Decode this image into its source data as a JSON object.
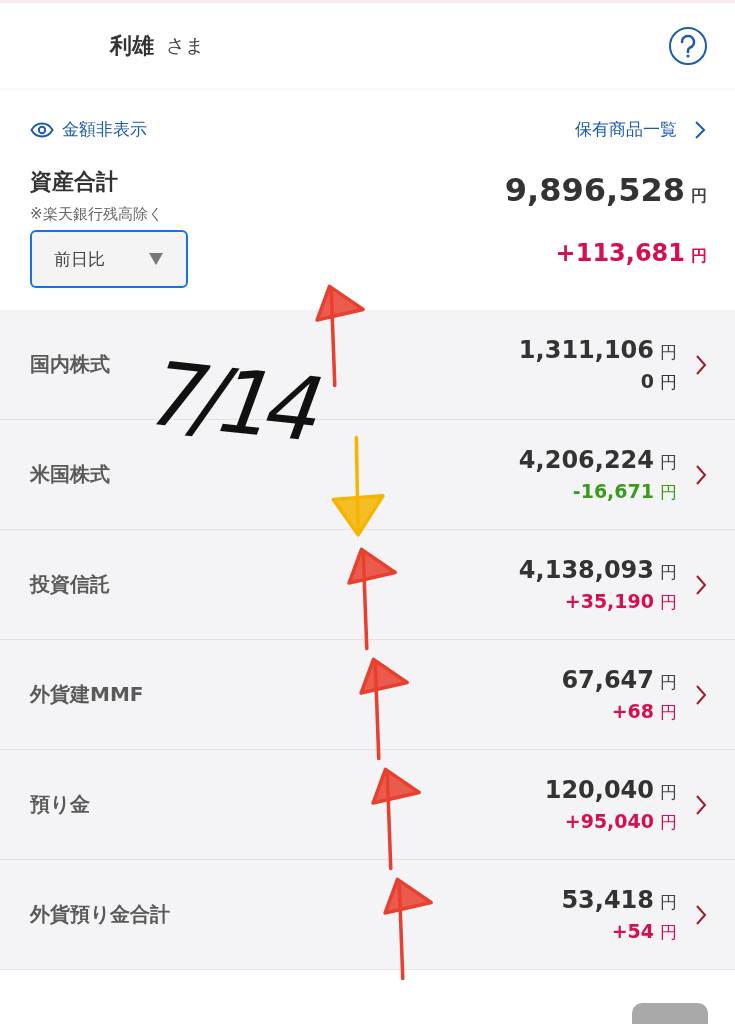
{
  "header": {
    "name": "利雄",
    "honorific": "さま"
  },
  "summary": {
    "hide_link": "金額非表示",
    "holdings_link": "保有商品一覧",
    "title": "資産合計",
    "note": "※楽天銀行残高除く",
    "period_select": "前日比",
    "total": "9,896,528",
    "total_unit": "円",
    "change": "+113,681",
    "change_unit": "円",
    "arrow": {
      "kind": "up",
      "color": "#e8402f"
    }
  },
  "handwritten_note": "7/14",
  "assets": [
    {
      "name": "国内株式",
      "amount": "1,311,106",
      "amount_unit": "円",
      "change": "0",
      "change_unit": "円",
      "color": "#333333"
    },
    {
      "name": "米国株式",
      "amount": "4,206,224",
      "amount_unit": "円",
      "change": "-16,671",
      "change_unit": "円",
      "color": "#3a9a1a",
      "arrow": {
        "kind": "down",
        "color": "#f5b400"
      }
    },
    {
      "name": "投資信託",
      "amount": "4,138,093",
      "amount_unit": "円",
      "change": "+35,190",
      "change_unit": "円",
      "color": "#d4104f",
      "arrow": {
        "kind": "up",
        "color": "#e8402f"
      }
    },
    {
      "name": "外貨建MMF",
      "amount": "67,647",
      "amount_unit": "円",
      "change": "+68",
      "change_unit": "円",
      "color": "#d4104f",
      "arrow": {
        "kind": "up",
        "color": "#e8402f"
      }
    },
    {
      "name": "預り金",
      "amount": "120,040",
      "amount_unit": "円",
      "change": "+95,040",
      "change_unit": "円",
      "color": "#d4104f",
      "arrow": {
        "kind": "up",
        "color": "#e8402f"
      }
    },
    {
      "name": "外貨預り金合計",
      "amount": "53,418",
      "amount_unit": "円",
      "change": "+54",
      "change_unit": "円",
      "color": "#d4104f",
      "arrow": {
        "kind": "up",
        "color": "#e8402f"
      }
    }
  ]
}
